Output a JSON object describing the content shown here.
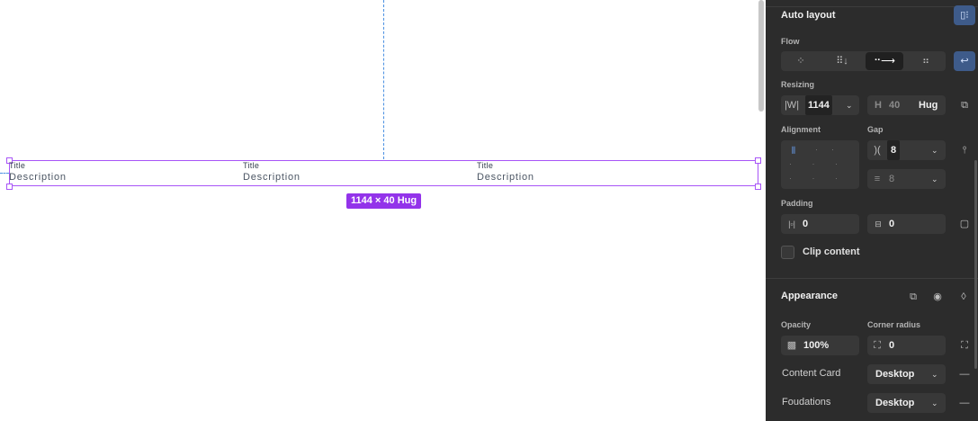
{
  "canvas": {
    "columns": [
      {
        "title": "Title",
        "description": "Description"
      },
      {
        "title": "Title",
        "description": "Description"
      },
      {
        "title": "Title",
        "description": "Description"
      }
    ],
    "size_badge": "1144 × 40 Hug"
  },
  "panel": {
    "auto_layout": {
      "heading": "Auto layout"
    },
    "flow": {
      "label": "Flow",
      "selected": "horizontal"
    },
    "resizing": {
      "label": "Resizing",
      "w_label": "W",
      "w_value": "1144",
      "h_label": "H",
      "h_value": "40",
      "h_mode": "Hug"
    },
    "alignment": {
      "label": "Alignment"
    },
    "gap": {
      "label": "Gap",
      "value": "8",
      "secondary_value": "8"
    },
    "padding": {
      "label": "Padding",
      "horizontal": "0",
      "vertical": "0"
    },
    "clip_content": {
      "label": "Clip content",
      "checked": false
    },
    "appearance": {
      "heading": "Appearance",
      "opacity_label": "Opacity",
      "opacity_value": "100%",
      "corner_label": "Corner radius",
      "corner_value": "0"
    },
    "variables": [
      {
        "name": "Content Card",
        "mode": "Desktop"
      },
      {
        "name": "Foudations",
        "mode": "Desktop"
      }
    ]
  },
  "colors": {
    "selection": "#a855f7",
    "badge": "#9333ea",
    "panel_bg": "#2c2c2c",
    "accent_button": "#3e5b8a"
  }
}
